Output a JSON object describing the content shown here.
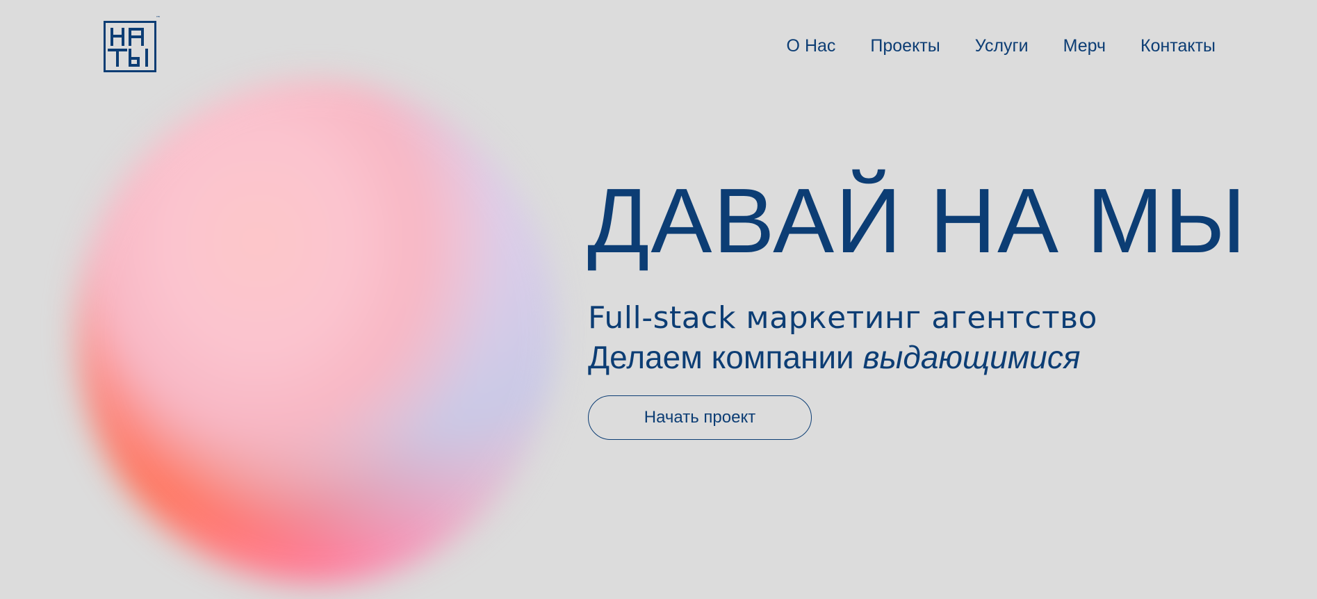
{
  "brand": {
    "logo_lines": [
      "НА",
      "ТЫ"
    ],
    "trademark": "™",
    "color": "#0c3d74"
  },
  "nav": {
    "items": [
      {
        "label": "О Нас"
      },
      {
        "label": "Проекты"
      },
      {
        "label": "Услуги"
      },
      {
        "label": "Мерч"
      },
      {
        "label": "Контакты"
      }
    ]
  },
  "hero": {
    "title": "ДАВАЙ НА МЫ",
    "subtitle_line1": "Full-stack маркетинг агентство",
    "subtitle_line2_prefix": "Делаем компании ",
    "subtitle_line2_emphasis": "выдающимися",
    "cta_label": "Начать проект"
  },
  "colors": {
    "background": "#dcdcdc",
    "text": "#0c3d74"
  }
}
